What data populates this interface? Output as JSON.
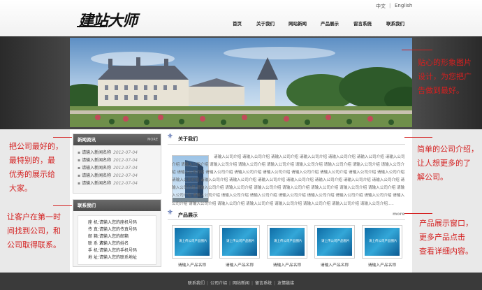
{
  "header": {
    "logo_text": "建站大师",
    "lang_zh": "中文",
    "lang_sep": "|",
    "lang_en": "English",
    "nav": [
      "首页",
      "关于我们",
      "网站新闻",
      "产品展示",
      "留言系统",
      "联系我们"
    ]
  },
  "callouts": {
    "banner_note": [
      "贴心的形象图片",
      "设计，为您把广",
      "告做到最好。"
    ],
    "news_note": [
      "把公司最好的，",
      "最特别的，最",
      "优秀的展示给",
      "大家。"
    ],
    "contact_note": [
      "让客户在第一时",
      "间找到公司，和",
      "公司取得联系。"
    ],
    "about_note": [
      "简单的公司介绍，",
      "让人想更多的了",
      "解公司。"
    ],
    "product_note": [
      "产品展示窗口，",
      "更多产品点击",
      "查看详细内容。"
    ]
  },
  "news": {
    "title": "新闻资讯",
    "more": "MORE",
    "items": [
      {
        "name": "请输入新闻名称",
        "date": "2012-07-04"
      },
      {
        "name": "请输入新闻名称",
        "date": "2012-07-04"
      },
      {
        "name": "请输入新闻名称",
        "date": "2012-07-04"
      },
      {
        "name": "请输入新闻名称",
        "date": "2012-07-04"
      },
      {
        "name": "请输入新闻名称",
        "date": "2012-07-04"
      }
    ]
  },
  "contact": {
    "title": "联系我们",
    "rows": [
      {
        "label": "座 机：",
        "value": "请输入您的座机号码"
      },
      {
        "label": "传 真：",
        "value": "请输入您的传真号码"
      },
      {
        "label": "邮 箱：",
        "value": "请输入您的邮箱"
      },
      {
        "label": "联 系 人：",
        "value": "请输入您的姓名"
      },
      {
        "label": "手 机：",
        "value": "请输入您的手机号码"
      },
      {
        "label": "地 址：",
        "value": "请输入您的联系地址"
      }
    ]
  },
  "about": {
    "title": "关于我们",
    "text": "请输入公司介绍 请输入公司介绍 请输入公司介绍 请输入公司介绍 请输入公司介绍 请输入公司介绍 请输入公司介绍 请输入公司介绍 请输入公司介绍 请输入公司介绍 请输入公司介绍 请输入公司介绍 请输入公司介绍 请输入公司介绍 请输入公司介绍 请输入公司介绍 请输入公司介绍 请输入公司介绍 请输入公司介绍 请输入公司介绍 请输入公司介绍 请输入公司介绍 请输入公司介绍 请输入公司介绍 请输入公司介绍 请输入公司介绍 请输入公司介绍 请输入公司介绍 请输入公司介绍 请输入公司介绍 请输入公司介绍 请输入公司介绍 请输入公司介绍 请输入公司介绍 请输入公司介绍 请输入公司介绍 请输入公司介绍 请输入公司介绍 请输入公司介绍 请输入公司介绍 请输入公司介绍 请输入公司介绍 请输入公司介绍 请输入公司介绍 请输入公司介绍 请输入公司介绍 请输入公司介绍 请输入公司介绍 请输入公司介绍 请输入公司介绍 请输入公司介绍 请输入公司介绍 请输入公司介绍 请输入公司介绍 请输入公司介绍....."
  },
  "products": {
    "title": "产品展示",
    "more": "more",
    "image_text": "请上传公司产品图片",
    "items": [
      "请输入产品名称",
      "请输入产品名称",
      "请输入产品名称",
      "请输入产品名称",
      "请输入产品名称"
    ]
  },
  "footer": {
    "links": [
      "联系我们",
      "公司介绍",
      "网站新闻",
      "留言系统",
      "友情链接"
    ],
    "sep": "|"
  }
}
